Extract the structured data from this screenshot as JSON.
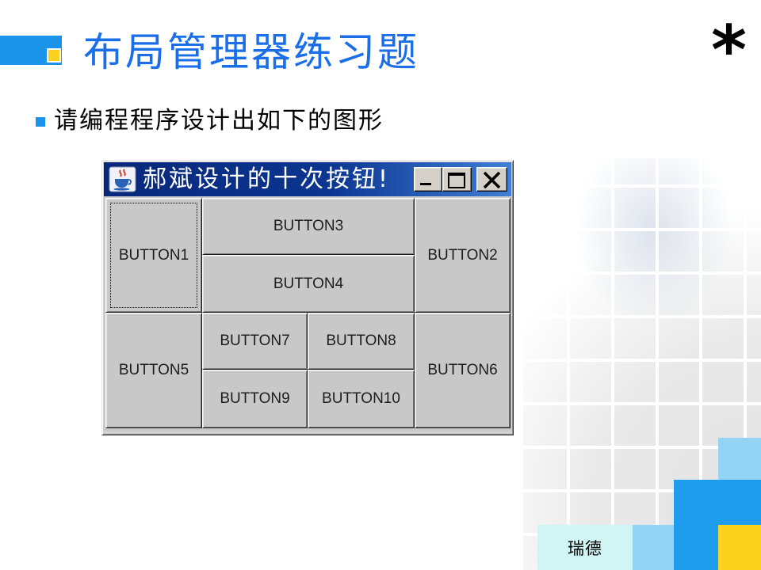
{
  "slide": {
    "title": "布局管理器练习题",
    "corner_mark": "*",
    "bullet": "请编程程序设计出如下的图形",
    "footer_label": "瑞德"
  },
  "window": {
    "title": "郝斌设计的十次按钮!",
    "app_icon": "java-cup-icon",
    "controls": {
      "minimize_icon": "minimize-icon",
      "maximize_icon": "maximize-icon",
      "close_icon": "close-icon"
    },
    "buttons": [
      {
        "label": "BUTTON1",
        "focused": true
      },
      {
        "label": "BUTTON2",
        "focused": false
      },
      {
        "label": "BUTTON3",
        "focused": false
      },
      {
        "label": "BUTTON4",
        "focused": false
      },
      {
        "label": "BUTTON5",
        "focused": false
      },
      {
        "label": "BUTTON6",
        "focused": false
      },
      {
        "label": "BUTTON7",
        "focused": false
      },
      {
        "label": "BUTTON8",
        "focused": false
      },
      {
        "label": "BUTTON9",
        "focused": false
      },
      {
        "label": "BUTTON10",
        "focused": false
      }
    ]
  },
  "colors": {
    "title_blue": "#1a6fe8",
    "accent_blue": "#1a94ea",
    "deco_blue": "#1e9def",
    "deco_light_blue": "#93d3f6",
    "deco_yellow": "#fdd21f",
    "footer_aqua": "#d0f5f4",
    "titlebar_start": "#08287a",
    "titlebar_end": "#3f7fd6",
    "button_face": "#c8c8c8"
  }
}
